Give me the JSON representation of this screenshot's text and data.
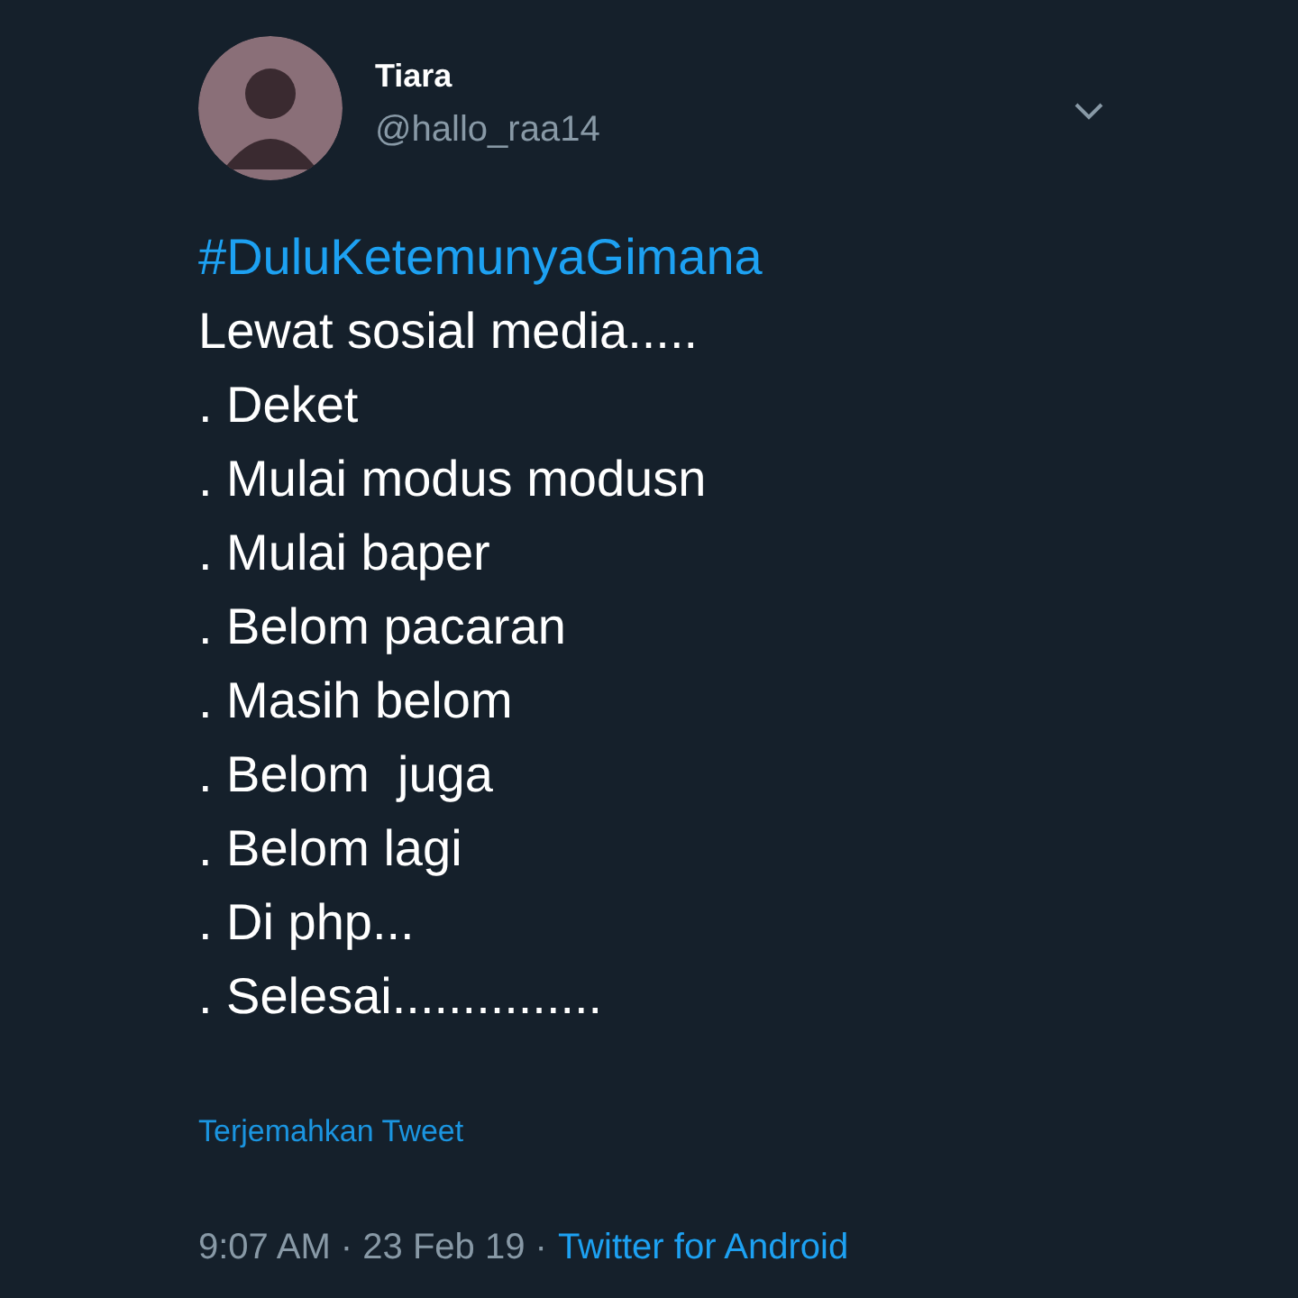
{
  "tweet": {
    "name": "Tiara",
    "handle": "@hallo_raa14",
    "hashtag": "#DuluKetemunyaGimana",
    "lines": [
      "Lewat sosial media.....",
      ". Deket",
      ". Mulai modus modusn",
      ". Mulai baper",
      ". Belom pacaran",
      ". Masih belom",
      ". Belom  juga",
      ". Belom lagi",
      ". Di php...",
      ". Selesai..............."
    ],
    "translate": "Terjemahkan Tweet",
    "timestamp": "9:07 AM · 23 Feb 19 ·",
    "source": "Twitter for Android"
  }
}
